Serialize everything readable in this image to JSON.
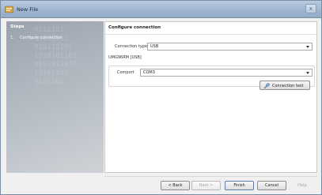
{
  "window": {
    "title": "New File",
    "close_glyph": "x"
  },
  "steps": {
    "heading": "Steps",
    "watermark": "0110101\n10101101\n010110101\n1010101101\n0101011010\n10101101\n0101101",
    "items": [
      {
        "number": "1.",
        "label": "Configure connection"
      }
    ]
  },
  "main": {
    "title": "Configure connection",
    "connection_type": {
      "label": "Connection type",
      "value": "USB"
    },
    "device": {
      "label": "UMG96RM [USB]"
    },
    "comport": {
      "label": "Comport",
      "value": "COM3"
    },
    "connection_test_label": "Connection test"
  },
  "footer": {
    "back": "< Back",
    "next": "Next >",
    "finish": "Finish",
    "cancel": "Cancel",
    "help": "Help"
  },
  "colors": {
    "steps_panel": "#9aa3ad",
    "title_bar": "#9fb6d1"
  }
}
